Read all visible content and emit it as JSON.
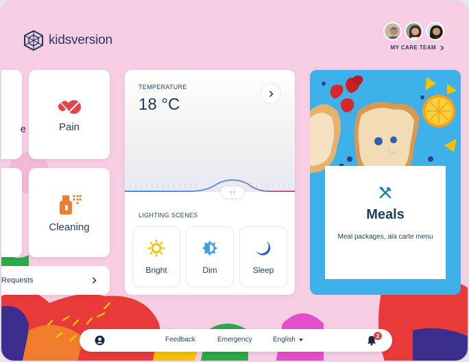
{
  "brand": {
    "name": "kidsversion"
  },
  "care_team": {
    "label": "MY CARE TEAM",
    "avatars": [
      "care-member-1",
      "care-member-2",
      "care-member-3"
    ]
  },
  "tiles": [
    {
      "label": "e",
      "icon": "partial-tile-icon"
    },
    {
      "label": "Pain",
      "icon": "pill-icon"
    },
    {
      "label": "Cleaning",
      "icon": "spray-bottle-icon"
    }
  ],
  "requests": {
    "label": "Requests"
  },
  "temperature": {
    "label": "TEMPERATURE",
    "value": "18 °C",
    "slider_handle": "‹ ›"
  },
  "lighting": {
    "label": "LIGHTING SCENES",
    "scenes": [
      {
        "label": "Bright",
        "icon": "sun-icon"
      },
      {
        "label": "Dim",
        "icon": "half-sun-icon"
      },
      {
        "label": "Sleep",
        "icon": "moon-icon"
      }
    ]
  },
  "meals": {
    "title": "Meals",
    "subtitle": "Meal packages, ala carte menu",
    "icon": "utensils-icon"
  },
  "bottom_bar": {
    "feedback": "Feedback",
    "emergency": "Emergency",
    "language": "English",
    "notifications": "2"
  },
  "colors": {
    "background": "#f6cde3",
    "text": "#1c3d5a",
    "accent_red": "#e0454a",
    "accent_orange": "#f07d2e",
    "accent_yellow": "#f2c300",
    "accent_blue": "#3fb1ea"
  }
}
